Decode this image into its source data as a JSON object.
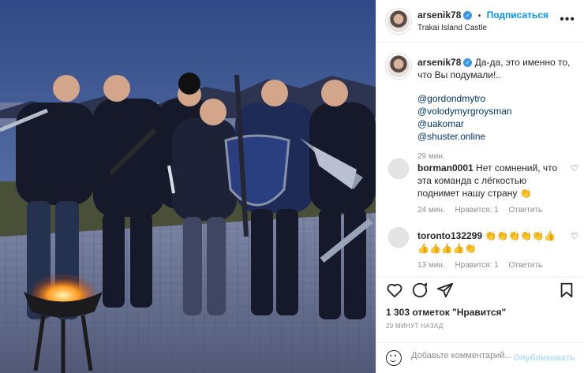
{
  "post": {
    "username": "arsenik78",
    "follow_label": "Подписаться",
    "dot": "•",
    "location": "Trakai Island Castle",
    "more": "•••"
  },
  "caption": {
    "username": "arsenik78",
    "text": "Да-да, это именно то, что Вы подумали!..",
    "mentions": [
      "@gordondmytro",
      "@volodymyrgroysman",
      "@uakomar",
      "@shuster.online"
    ],
    "time": "29 мин."
  },
  "comments": [
    {
      "username": "borman0001",
      "text": "Нет сомнений, что эта команда с лёгкостью поднимет нашу страну 👏",
      "time": "24 мин.",
      "likes": "Нравится: 1",
      "reply": "Ответить"
    },
    {
      "username": "toronto132299",
      "text": "👏👏👏👏👏👍👍👍👍👍👏",
      "time": "13 мин.",
      "likes": "Нравится: 1",
      "reply": "Ответить"
    }
  ],
  "stats": {
    "likes": "1 303 отметок \"Нравится\"",
    "timestamp": "29 МИНУТ НАЗАД"
  },
  "composer": {
    "placeholder": "Добавьте комментарий...",
    "publish": "Опубликовать"
  },
  "icons": {
    "verified": "verified-badge-icon",
    "like": "heart-icon",
    "comment": "comment-icon",
    "share": "paper-plane-icon",
    "save": "bookmark-icon",
    "emoji": "smile-icon"
  },
  "colors": {
    "accent": "#0095f6",
    "verified": "#3897f0",
    "muted": "#8e8e8e",
    "publish_disabled": "#b2dffc",
    "mention": "#00376b"
  }
}
